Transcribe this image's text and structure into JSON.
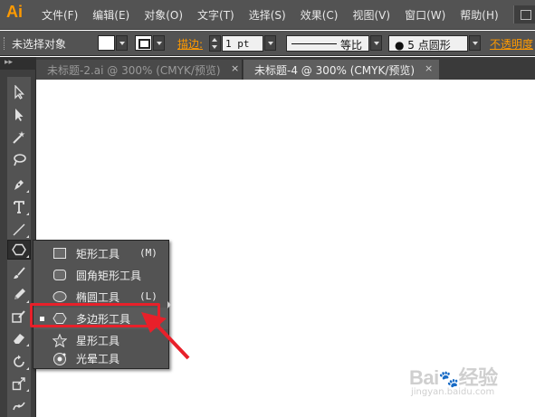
{
  "app": {
    "logo": "Ai"
  },
  "menu": {
    "items": [
      "文件(F)",
      "编辑(E)",
      "对象(O)",
      "文字(T)",
      "选择(S)",
      "效果(C)",
      "视图(V)",
      "窗口(W)",
      "帮助(H)"
    ]
  },
  "control_bar": {
    "selection_label": "未选择对象",
    "stroke_label": "描边:",
    "stroke_weight": "1 pt",
    "line_style_label": "等比",
    "brush_label": "●  5 点圆形",
    "opacity_label": "不透明度"
  },
  "tabs": [
    {
      "label": "未标题-2.ai @ 300% (CMYK/预览)",
      "close": "×",
      "active": false
    },
    {
      "label": "未标题-4 @ 300% (CMYK/预览)",
      "close": "×",
      "active": true
    }
  ],
  "tools_panel": {
    "collapse_label": "▸▸"
  },
  "flyout": {
    "items": [
      {
        "icon": "rectangle-icon",
        "label": "矩形工具",
        "shortcut": "(M)"
      },
      {
        "icon": "rounded-rectangle-icon",
        "label": "圆角矩形工具",
        "shortcut": ""
      },
      {
        "icon": "ellipse-icon",
        "label": "椭圆工具",
        "shortcut": "(L)"
      },
      {
        "icon": "polygon-icon",
        "label": "多边形工具",
        "shortcut": "",
        "selected": true
      },
      {
        "icon": "star-icon",
        "label": "星形工具",
        "shortcut": ""
      },
      {
        "icon": "flare-icon",
        "label": "光晕工具",
        "shortcut": ""
      }
    ]
  },
  "annotation": {
    "color": "#e8202a"
  },
  "watermark": {
    "brand_a": "Bai",
    "brand_b": "经验",
    "url": "jingyan.baidu.com"
  },
  "colors": {
    "ui_dark": "#535353",
    "accent_orange": "#ff9a00"
  }
}
